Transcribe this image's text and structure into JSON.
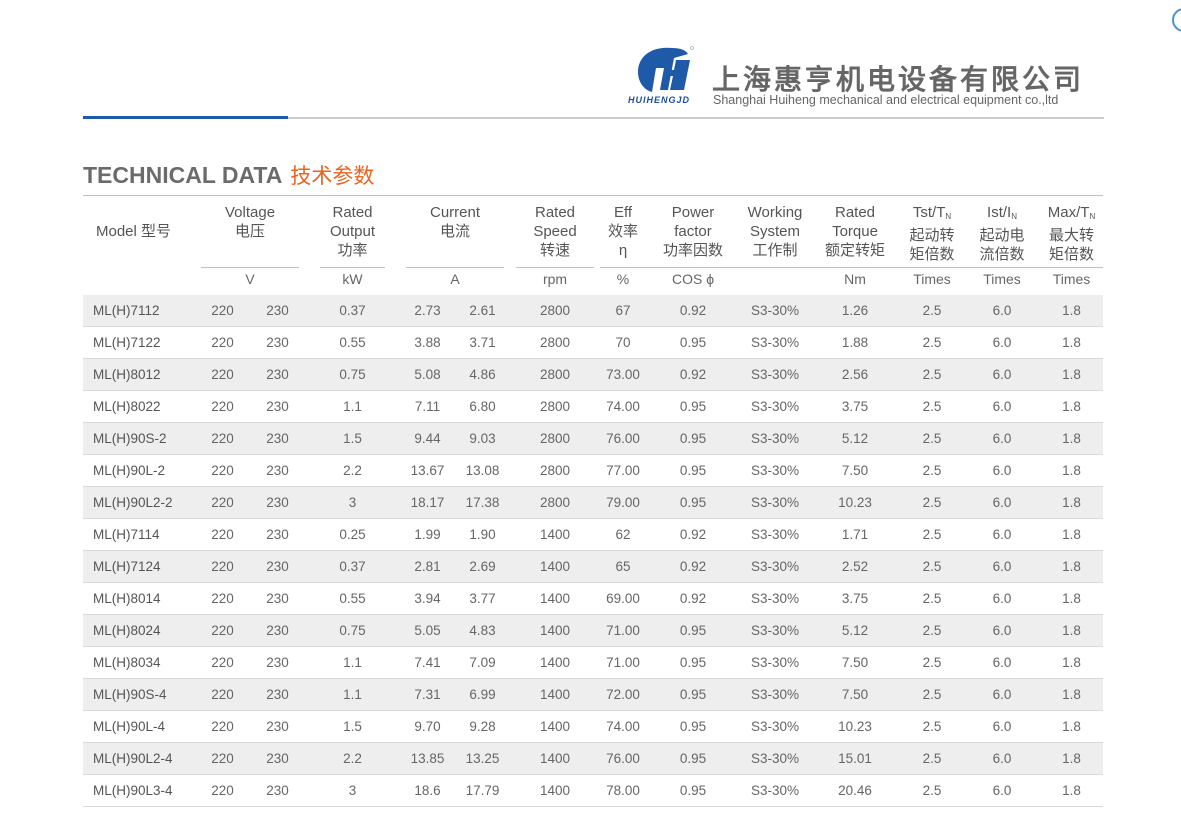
{
  "header": {
    "brand_en": "HUIHENGJD",
    "company_cn": "上海惠亨机电设备有限公司",
    "company_en": "Shanghai Huiheng mechanical and electrical equipment co.,ltd",
    "accent": "#1f5aa8"
  },
  "section": {
    "title": "TECHNICAL DATA",
    "title_cn": "技术参数"
  },
  "columns": {
    "model": "Model 型号",
    "voltage": [
      "Voltage",
      "电压"
    ],
    "voltage_unit": "V",
    "output": [
      "Rated",
      "Output",
      "功率"
    ],
    "output_unit": "kW",
    "current": [
      "Current",
      "电流"
    ],
    "current_unit": "A",
    "speed": [
      "Rated",
      "Speed",
      "转速"
    ],
    "speed_unit": "rpm",
    "eff": [
      "Eff",
      "效率",
      "η"
    ],
    "eff_unit": "%",
    "pf": [
      "Power",
      "factor",
      "功率因数"
    ],
    "pf_unit": "COS ϕ",
    "ws": [
      "Working",
      "System",
      "工作制"
    ],
    "torque": [
      "Rated",
      "Torque",
      "额定转矩"
    ],
    "torque_unit": "Nm",
    "tst": [
      "Tst/T",
      "N",
      "起动转",
      "矩倍数"
    ],
    "tst_unit": "Times",
    "ist": [
      "Ist/I",
      "N",
      "起动电",
      "流倍数"
    ],
    "ist_unit": "Times",
    "max": [
      "Max/T",
      "N",
      "最大转",
      "矩倍数"
    ],
    "max_unit": "Times"
  },
  "rows": [
    [
      "ML(H)7112",
      "220",
      "230",
      "0.37",
      "2.73",
      "2.61",
      "2800",
      "67",
      "0.92",
      "S3-30%",
      "1.26",
      "2.5",
      "6.0",
      "1.8"
    ],
    [
      "ML(H)7122",
      "220",
      "230",
      "0.55",
      "3.88",
      "3.71",
      "2800",
      "70",
      "0.95",
      "S3-30%",
      "1.88",
      "2.5",
      "6.0",
      "1.8"
    ],
    [
      "ML(H)8012",
      "220",
      "230",
      "0.75",
      "5.08",
      "4.86",
      "2800",
      "73.00",
      "0.92",
      "S3-30%",
      "2.56",
      "2.5",
      "6.0",
      "1.8"
    ],
    [
      "ML(H)8022",
      "220",
      "230",
      "1.1",
      "7.11",
      "6.80",
      "2800",
      "74.00",
      "0.95",
      "S3-30%",
      "3.75",
      "2.5",
      "6.0",
      "1.8"
    ],
    [
      "ML(H)90S-2",
      "220",
      "230",
      "1.5",
      "9.44",
      "9.03",
      "2800",
      "76.00",
      "0.95",
      "S3-30%",
      "5.12",
      "2.5",
      "6.0",
      "1.8"
    ],
    [
      "ML(H)90L-2",
      "220",
      "230",
      "2.2",
      "13.67",
      "13.08",
      "2800",
      "77.00",
      "0.95",
      "S3-30%",
      "7.50",
      "2.5",
      "6.0",
      "1.8"
    ],
    [
      "ML(H)90L2-2",
      "220",
      "230",
      "3",
      "18.17",
      "17.38",
      "2800",
      "79.00",
      "0.95",
      "S3-30%",
      "10.23",
      "2.5",
      "6.0",
      "1.8"
    ],
    [
      "ML(H)7114",
      "220",
      "230",
      "0.25",
      "1.99",
      "1.90",
      "1400",
      "62",
      "0.92",
      "S3-30%",
      "1.71",
      "2.5",
      "6.0",
      "1.8"
    ],
    [
      "ML(H)7124",
      "220",
      "230",
      "0.37",
      "2.81",
      "2.69",
      "1400",
      "65",
      "0.92",
      "S3-30%",
      "2.52",
      "2.5",
      "6.0",
      "1.8"
    ],
    [
      "ML(H)8014",
      "220",
      "230",
      "0.55",
      "3.94",
      "3.77",
      "1400",
      "69.00",
      "0.92",
      "S3-30%",
      "3.75",
      "2.5",
      "6.0",
      "1.8"
    ],
    [
      "ML(H)8024",
      "220",
      "230",
      "0.75",
      "5.05",
      "4.83",
      "1400",
      "71.00",
      "0.95",
      "S3-30%",
      "5.12",
      "2.5",
      "6.0",
      "1.8"
    ],
    [
      "ML(H)8034",
      "220",
      "230",
      "1.1",
      "7.41",
      "7.09",
      "1400",
      "71.00",
      "0.95",
      "S3-30%",
      "7.50",
      "2.5",
      "6.0",
      "1.8"
    ],
    [
      "ML(H)90S-4",
      "220",
      "230",
      "1.1",
      "7.31",
      "6.99",
      "1400",
      "72.00",
      "0.95",
      "S3-30%",
      "7.50",
      "2.5",
      "6.0",
      "1.8"
    ],
    [
      "ML(H)90L-4",
      "220",
      "230",
      "1.5",
      "9.70",
      "9.28",
      "1400",
      "74.00",
      "0.95",
      "S3-30%",
      "10.23",
      "2.5",
      "6.0",
      "1.8"
    ],
    [
      "ML(H)90L2-4",
      "220",
      "230",
      "2.2",
      "13.85",
      "13.25",
      "1400",
      "76.00",
      "0.95",
      "S3-30%",
      "15.01",
      "2.5",
      "6.0",
      "1.8"
    ],
    [
      "ML(H)90L3-4",
      "220",
      "230",
      "3",
      "18.6",
      "17.79",
      "1400",
      "78.00",
      "0.95",
      "S3-30%",
      "20.46",
      "2.5",
      "6.0",
      "1.8"
    ]
  ]
}
